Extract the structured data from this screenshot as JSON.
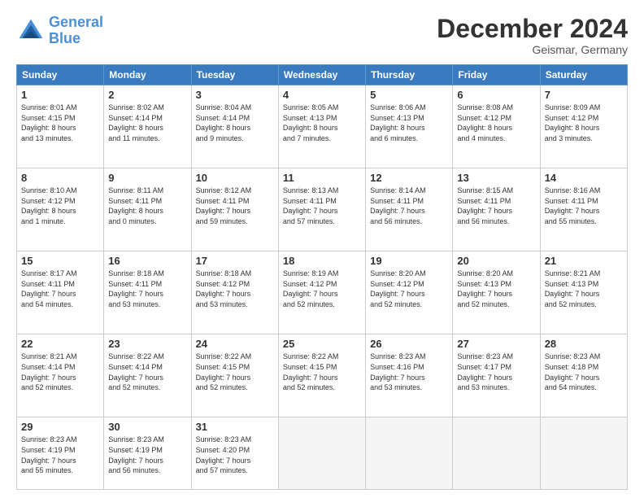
{
  "header": {
    "logo_line1": "General",
    "logo_line2": "Blue",
    "month_title": "December 2024",
    "location": "Geismar, Germany"
  },
  "weekdays": [
    "Sunday",
    "Monday",
    "Tuesday",
    "Wednesday",
    "Thursday",
    "Friday",
    "Saturday"
  ],
  "weeks": [
    [
      {
        "day": "1",
        "info": "Sunrise: 8:01 AM\nSunset: 4:15 PM\nDaylight: 8 hours\nand 13 minutes."
      },
      {
        "day": "2",
        "info": "Sunrise: 8:02 AM\nSunset: 4:14 PM\nDaylight: 8 hours\nand 11 minutes."
      },
      {
        "day": "3",
        "info": "Sunrise: 8:04 AM\nSunset: 4:14 PM\nDaylight: 8 hours\nand 9 minutes."
      },
      {
        "day": "4",
        "info": "Sunrise: 8:05 AM\nSunset: 4:13 PM\nDaylight: 8 hours\nand 7 minutes."
      },
      {
        "day": "5",
        "info": "Sunrise: 8:06 AM\nSunset: 4:13 PM\nDaylight: 8 hours\nand 6 minutes."
      },
      {
        "day": "6",
        "info": "Sunrise: 8:08 AM\nSunset: 4:12 PM\nDaylight: 8 hours\nand 4 minutes."
      },
      {
        "day": "7",
        "info": "Sunrise: 8:09 AM\nSunset: 4:12 PM\nDaylight: 8 hours\nand 3 minutes."
      }
    ],
    [
      {
        "day": "8",
        "info": "Sunrise: 8:10 AM\nSunset: 4:12 PM\nDaylight: 8 hours\nand 1 minute."
      },
      {
        "day": "9",
        "info": "Sunrise: 8:11 AM\nSunset: 4:11 PM\nDaylight: 8 hours\nand 0 minutes."
      },
      {
        "day": "10",
        "info": "Sunrise: 8:12 AM\nSunset: 4:11 PM\nDaylight: 7 hours\nand 59 minutes."
      },
      {
        "day": "11",
        "info": "Sunrise: 8:13 AM\nSunset: 4:11 PM\nDaylight: 7 hours\nand 57 minutes."
      },
      {
        "day": "12",
        "info": "Sunrise: 8:14 AM\nSunset: 4:11 PM\nDaylight: 7 hours\nand 56 minutes."
      },
      {
        "day": "13",
        "info": "Sunrise: 8:15 AM\nSunset: 4:11 PM\nDaylight: 7 hours\nand 56 minutes."
      },
      {
        "day": "14",
        "info": "Sunrise: 8:16 AM\nSunset: 4:11 PM\nDaylight: 7 hours\nand 55 minutes."
      }
    ],
    [
      {
        "day": "15",
        "info": "Sunrise: 8:17 AM\nSunset: 4:11 PM\nDaylight: 7 hours\nand 54 minutes."
      },
      {
        "day": "16",
        "info": "Sunrise: 8:18 AM\nSunset: 4:11 PM\nDaylight: 7 hours\nand 53 minutes."
      },
      {
        "day": "17",
        "info": "Sunrise: 8:18 AM\nSunset: 4:12 PM\nDaylight: 7 hours\nand 53 minutes."
      },
      {
        "day": "18",
        "info": "Sunrise: 8:19 AM\nSunset: 4:12 PM\nDaylight: 7 hours\nand 52 minutes."
      },
      {
        "day": "19",
        "info": "Sunrise: 8:20 AM\nSunset: 4:12 PM\nDaylight: 7 hours\nand 52 minutes."
      },
      {
        "day": "20",
        "info": "Sunrise: 8:20 AM\nSunset: 4:13 PM\nDaylight: 7 hours\nand 52 minutes."
      },
      {
        "day": "21",
        "info": "Sunrise: 8:21 AM\nSunset: 4:13 PM\nDaylight: 7 hours\nand 52 minutes."
      }
    ],
    [
      {
        "day": "22",
        "info": "Sunrise: 8:21 AM\nSunset: 4:14 PM\nDaylight: 7 hours\nand 52 minutes."
      },
      {
        "day": "23",
        "info": "Sunrise: 8:22 AM\nSunset: 4:14 PM\nDaylight: 7 hours\nand 52 minutes."
      },
      {
        "day": "24",
        "info": "Sunrise: 8:22 AM\nSunset: 4:15 PM\nDaylight: 7 hours\nand 52 minutes."
      },
      {
        "day": "25",
        "info": "Sunrise: 8:22 AM\nSunset: 4:15 PM\nDaylight: 7 hours\nand 52 minutes."
      },
      {
        "day": "26",
        "info": "Sunrise: 8:23 AM\nSunset: 4:16 PM\nDaylight: 7 hours\nand 53 minutes."
      },
      {
        "day": "27",
        "info": "Sunrise: 8:23 AM\nSunset: 4:17 PM\nDaylight: 7 hours\nand 53 minutes."
      },
      {
        "day": "28",
        "info": "Sunrise: 8:23 AM\nSunset: 4:18 PM\nDaylight: 7 hours\nand 54 minutes."
      }
    ],
    [
      {
        "day": "29",
        "info": "Sunrise: 8:23 AM\nSunset: 4:19 PM\nDaylight: 7 hours\nand 55 minutes."
      },
      {
        "day": "30",
        "info": "Sunrise: 8:23 AM\nSunset: 4:19 PM\nDaylight: 7 hours\nand 56 minutes."
      },
      {
        "day": "31",
        "info": "Sunrise: 8:23 AM\nSunset: 4:20 PM\nDaylight: 7 hours\nand 57 minutes."
      },
      {
        "day": "",
        "info": ""
      },
      {
        "day": "",
        "info": ""
      },
      {
        "day": "",
        "info": ""
      },
      {
        "day": "",
        "info": ""
      }
    ]
  ]
}
